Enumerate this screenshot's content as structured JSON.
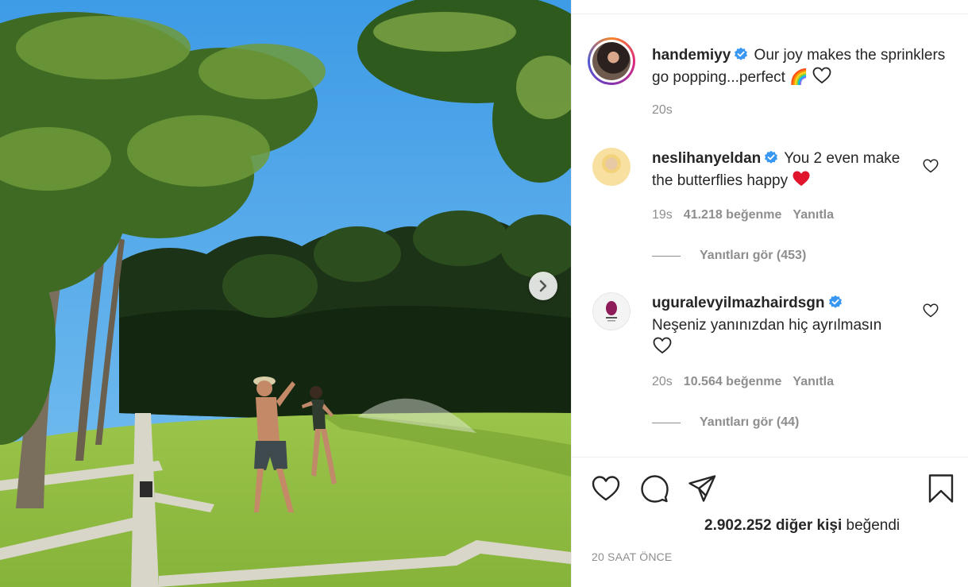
{
  "post": {
    "author": "handemiyy",
    "caption": "Our joy makes the sprinklers go popping...perfect 🌈",
    "caption_time": "20s"
  },
  "comments": [
    {
      "username": "neslihanyeldan",
      "text": "You 2 even make the butterflies happy",
      "time": "19s",
      "likes": "41.218 beğenme",
      "reply": "Yanıtla",
      "view_replies": "Yanıtları gör (453)"
    },
    {
      "username": "uguralevyilmazhairdsgn",
      "text": "Neşeniz yanınızdan hiç ayrılmasın",
      "time": "20s",
      "likes": "10.564 beğenme",
      "reply": "Yanıtla",
      "view_replies": "Yanıtları gör (44)"
    }
  ],
  "footer": {
    "likes_count": "2.902.252",
    "likes_others": "diğer kişi",
    "likes_suffix": "beğendi",
    "posted_ago": "20 SAAT ÖNCE"
  },
  "icons": {
    "verified": "verified-badge-icon",
    "like": "heart-icon",
    "comment": "comment-icon",
    "share": "share-icon",
    "save": "bookmark-icon",
    "next": "chevron-right-icon"
  },
  "colors": {
    "verified": "#3897f0",
    "muted": "#8e8e8e",
    "heart_red": "#ed4956"
  }
}
